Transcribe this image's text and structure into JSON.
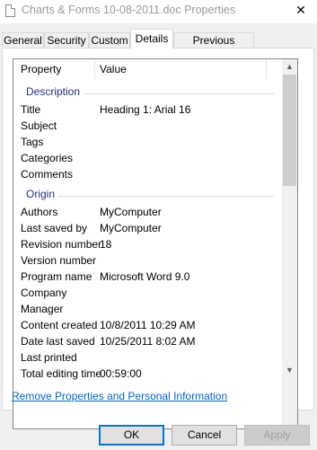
{
  "window": {
    "title": "Charts & Forms 10-08-2011.doc Properties",
    "close_glyph": "✕"
  },
  "tabs": [
    {
      "label": "General"
    },
    {
      "label": "Security"
    },
    {
      "label": "Custom"
    },
    {
      "label": "Details",
      "active": true
    },
    {
      "label": "Previous Versions"
    }
  ],
  "list": {
    "columns": {
      "property": "Property",
      "value": "Value"
    },
    "groups": {
      "description": "Description",
      "origin": "Origin"
    },
    "rows": [
      {
        "name": "Title",
        "value": "Heading 1: Arial 16"
      },
      {
        "name": "Subject",
        "value": ""
      },
      {
        "name": "Tags",
        "value": ""
      },
      {
        "name": "Categories",
        "value": ""
      },
      {
        "name": "Comments",
        "value": ""
      },
      {
        "name": "Authors",
        "value": "MyComputer"
      },
      {
        "name": "Last saved by",
        "value": "MyComputer"
      },
      {
        "name": "Revision number",
        "value": "18"
      },
      {
        "name": "Version number",
        "value": ""
      },
      {
        "name": "Program name",
        "value": "Microsoft Word 9.0"
      },
      {
        "name": "Company",
        "value": ""
      },
      {
        "name": "Manager",
        "value": ""
      },
      {
        "name": "Content created",
        "value": "10/8/2011 10:29 AM"
      },
      {
        "name": "Date last saved",
        "value": "10/25/2011 8:02 AM"
      },
      {
        "name": "Last printed",
        "value": ""
      },
      {
        "name": "Total editing time",
        "value": "00:59:00"
      }
    ],
    "scroll_up_glyph": "▲",
    "scroll_down_glyph": "▼"
  },
  "remove_link": "Remove Properties and Personal Information",
  "buttons": {
    "ok": "OK",
    "cancel": "Cancel",
    "apply": "Apply"
  }
}
